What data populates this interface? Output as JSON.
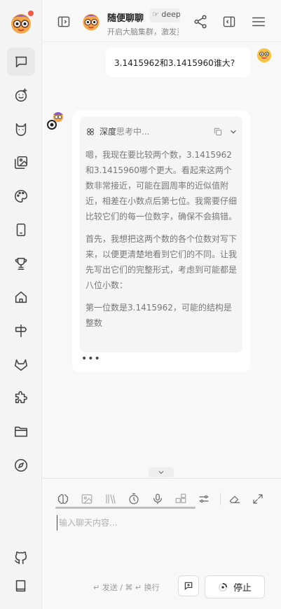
{
  "header": {
    "title": "随便聊聊",
    "model_tag": "deepseek",
    "subtitle": "开启大脑集群，激发灵感"
  },
  "chat": {
    "user_message": "3.1415962和3.1415960谁大?",
    "thinking": {
      "brand": "深度",
      "state": "思考中...",
      "paragraphs": [
        "嗯，我现在要比较两个数，3.1415962和3.1415960哪个更大。看起来这两个数非常接近，可能在圆周率的近似值附近，相差在小数点后第七位。我需要仔细比较它们的每一位数字，确保不会搞错。",
        "首先，我想把这两个数的各个位数对写下来，以便更清楚地看到它们的不同。让我先写出它们的完整形式，考虑到可能都是八位小数：",
        "第一位数是3.1415962，可能的结构是整数"
      ]
    },
    "typing_indicator": "•••"
  },
  "composer": {
    "placeholder": "输入聊天内容...",
    "hint": "↵ 发送 / ⌘ ↵ 换行",
    "stop_label": "停止"
  },
  "icons": {
    "sidebar": [
      "chat-icon",
      "smiley-add-icon",
      "cat-icon",
      "gallery-icon",
      "palette-icon",
      "mobile-icon",
      "trophy-icon",
      "home-icon",
      "signpost-icon",
      "fox-icon",
      "puzzle-icon",
      "folder-icon",
      "compass-icon",
      "github-icon",
      "book-icon"
    ],
    "toolbar": [
      "brain-icon",
      "image-icon",
      "library-icon",
      "timer-icon",
      "mic-icon",
      "plugin-icon",
      "sliders-icon",
      "eraser-icon",
      "expand-icon"
    ]
  },
  "colors": {
    "accent_dot": "#f25a45",
    "background": "#f8f8f8",
    "card": "#ffffff"
  }
}
